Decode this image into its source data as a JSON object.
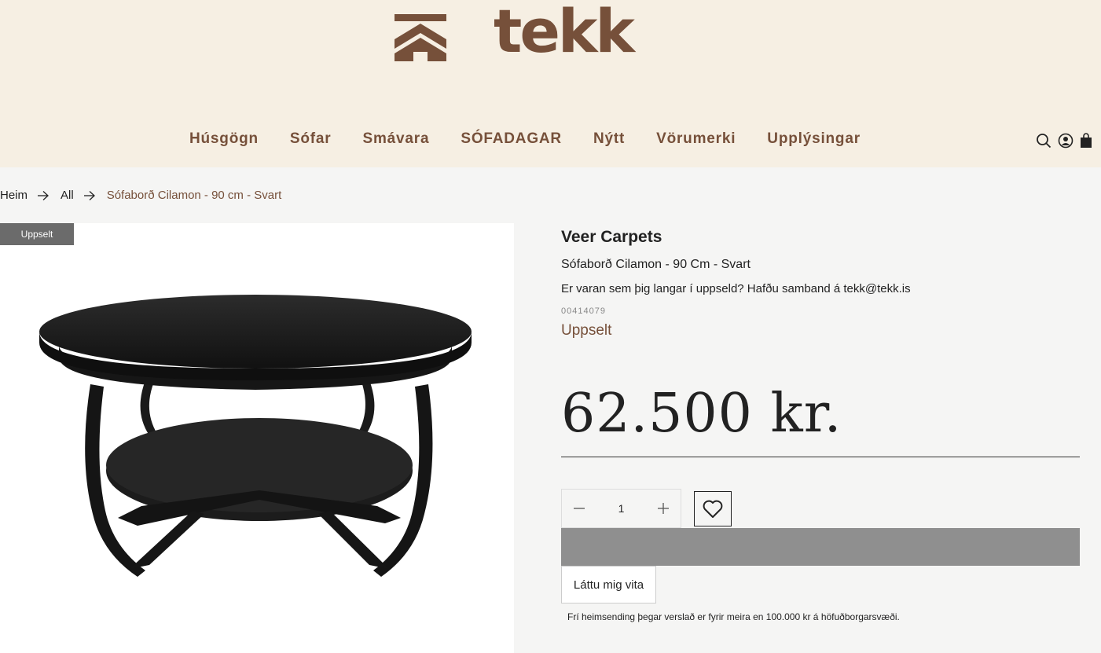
{
  "brand": {
    "name": "tekk",
    "color": "#76503a"
  },
  "nav": {
    "items": [
      "Húsgögn",
      "Sófar",
      "Smávara",
      "SÓFADAGAR",
      "Nýtt",
      "Vörumerki",
      "Upplýsingar"
    ],
    "icons": [
      "search-icon",
      "account-icon",
      "cart-icon"
    ]
  },
  "breadcrumb": {
    "home": "Heim",
    "all": "All",
    "current": "Sófaborð Cilamon - 90 cm - Svart"
  },
  "product": {
    "badge": "Uppselt",
    "vendor": "Veer Carpets",
    "title": "Sófaborð Cilamon - 90 Cm - Svart",
    "notice": "Er varan sem þig langar í uppseld? Hafðu samband á tekk@tekk.is",
    "sku": "00414079",
    "stock_status": "Uppselt",
    "price": "62.500 kr.",
    "quantity": "1",
    "notify_label": "Láttu mig vita",
    "shipping_note": "Frí heimsending þegar verslað er fyrir meira en 100.000 kr á höfuðborgarsvæði."
  },
  "colors": {
    "header_bg": "#f6efe3",
    "accent": "#76503a",
    "disabled_button": "#8f8f8f"
  }
}
